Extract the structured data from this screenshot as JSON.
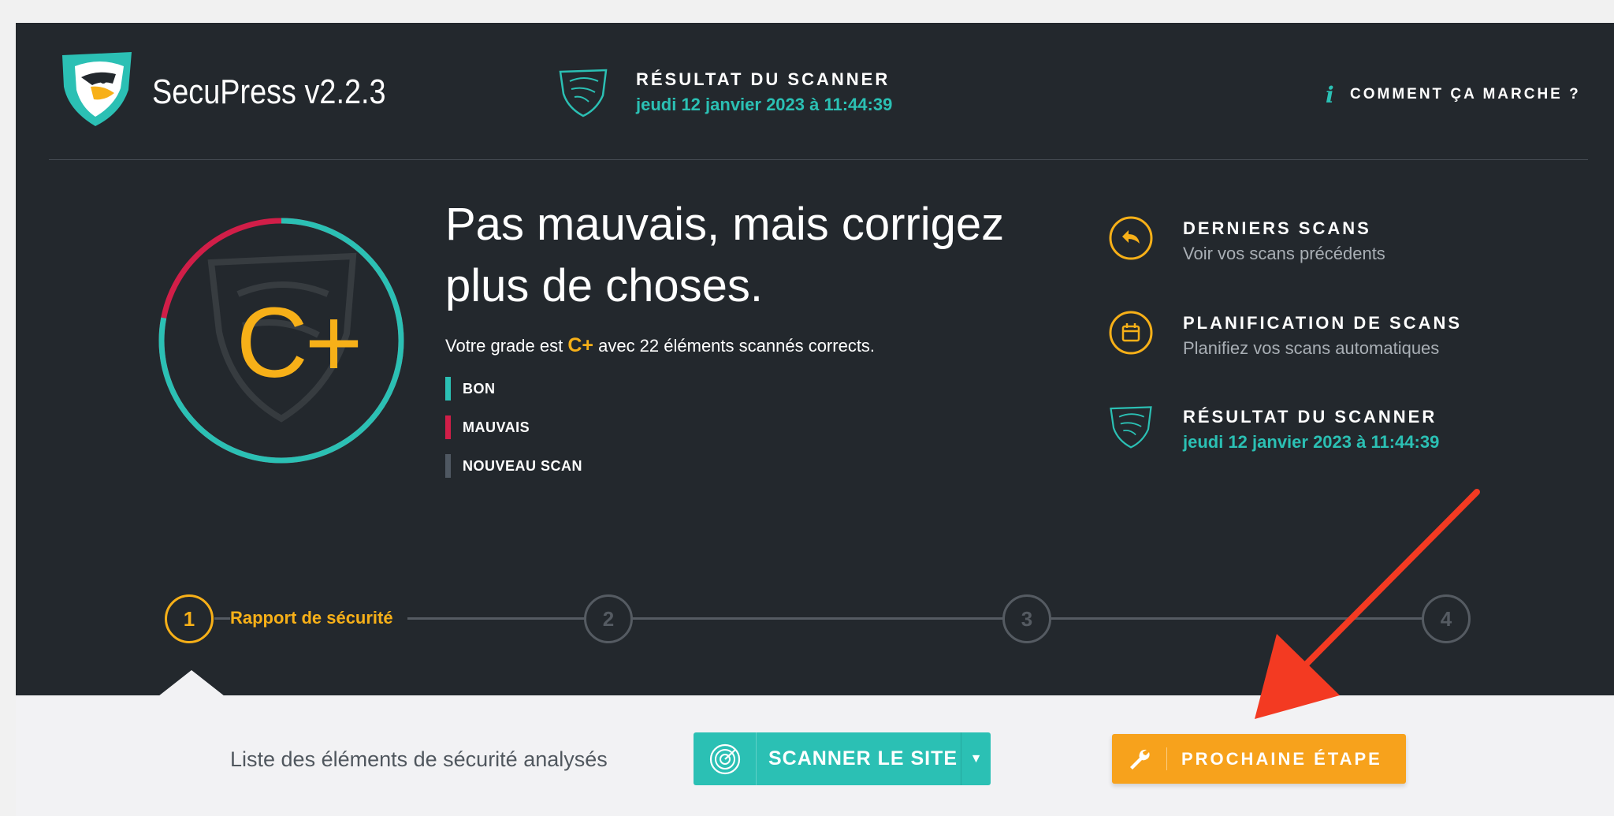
{
  "header": {
    "app_title": "SecuPress v2.2.3",
    "scan_result_label": "RÉSULTAT DU SCANNER",
    "scan_result_date": "jeudi 12 janvier 2023 à 11:44:39",
    "how_it_works_icon": "i",
    "how_it_works_label": "COMMENT ÇA MARCHE ?"
  },
  "grade": {
    "value": "C+",
    "headline": "Pas mauvais, mais corrigez plus de choses.",
    "sentence_prefix": "Votre grade est ",
    "sentence_grade": "C+",
    "sentence_suffix": " avec 22 éléments scannés corrects.",
    "ring_good_fraction": 0.78,
    "ring_bad_fraction": 0.22
  },
  "legend": [
    {
      "label": "BON",
      "color": "#2bc0b4"
    },
    {
      "label": "MAUVAIS",
      "color": "#d11e48"
    },
    {
      "label": "NOUVEAU SCAN",
      "color": "#4f5862"
    }
  ],
  "side_menu": [
    {
      "label": "DERNIERS SCANS",
      "sub": "Voir vos scans précédents",
      "icon": "history-icon"
    },
    {
      "label": "PLANIFICATION DE SCANS",
      "sub": "Planifiez vos scans automatiques",
      "icon": "calendar-icon"
    },
    {
      "label": "RÉSULTAT DU SCANNER",
      "sub": "jeudi 12 janvier 2023 à 11:44:39",
      "icon": "secupress-shield-icon"
    }
  ],
  "steps": [
    {
      "number": "1",
      "label": "Rapport de sécurité",
      "active": true
    },
    {
      "number": "2"
    },
    {
      "number": "3"
    },
    {
      "number": "4"
    }
  ],
  "footer": {
    "list_label": "Liste des éléments de sécurité analysés",
    "scan_button_label": "SCANNER LE SITE",
    "scan_dropdown_glyph": "▼",
    "next_button_label": "PROCHAINE ÉTAPE"
  },
  "colors": {
    "panel": "#23282d",
    "teal": "#2bc0b4",
    "orange": "#f7b018",
    "red": "#d11e48",
    "arrow": "#f33a22"
  }
}
